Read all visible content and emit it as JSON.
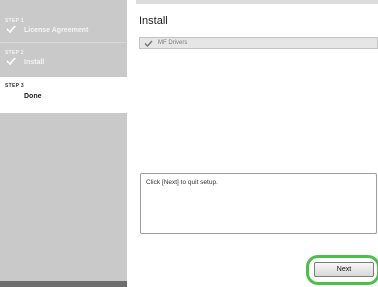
{
  "sidebar": {
    "steps": [
      {
        "label": "STEP 1",
        "title": "License Agreement",
        "state": "done"
      },
      {
        "label": "STEP 2",
        "title": "Install",
        "state": "done"
      },
      {
        "label": "STEP 3",
        "title": "Done",
        "state": "current"
      }
    ]
  },
  "main": {
    "title": "Install",
    "driver_label": "MF Drivers",
    "message": "Click [Next] to quit setup.",
    "next_label": "Next"
  },
  "colors": {
    "sidebar_bg": "#c9c9c9",
    "highlight": "#4cbf4a"
  }
}
